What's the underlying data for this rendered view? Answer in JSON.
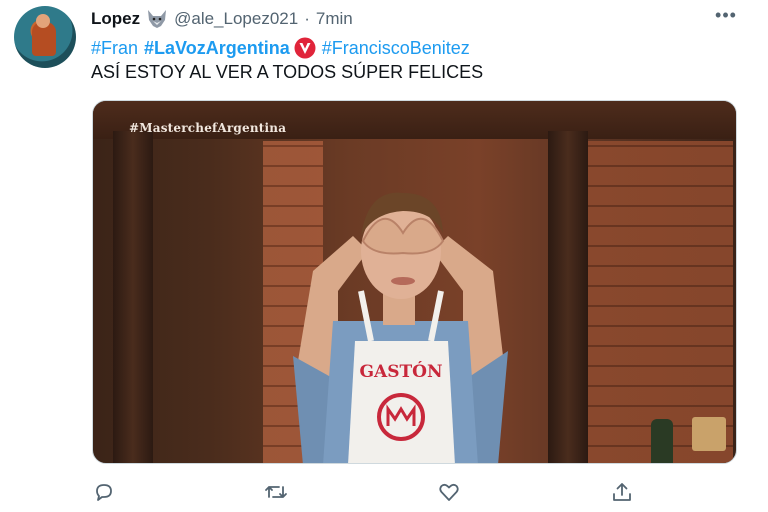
{
  "tweet": {
    "author_name": "Lopez",
    "author_handle": "@ale_Lopez021",
    "separator": "·",
    "time": "7min",
    "hashtags": {
      "tag1": "#Fran",
      "tag2": "#LaVozArgentina",
      "tag3": "#FranciscoBenitez"
    },
    "text": "ASÍ ESTOY AL VER A TODOS SÚPER FELICES",
    "media": {
      "watermark": "#MasterchefArgentina",
      "apron_name": "GASTÓN"
    },
    "more_label": "•••"
  },
  "colors": {
    "link": "#1d9bf0",
    "muted": "#536471",
    "text": "#0f1419",
    "voz_badge": "#e0243a"
  },
  "icons": {
    "author_badge": "wolf-emoji-icon",
    "hashtag_badge": "la-voz-icon",
    "actions": [
      "reply-icon",
      "retweet-icon",
      "like-icon",
      "share-icon"
    ]
  }
}
